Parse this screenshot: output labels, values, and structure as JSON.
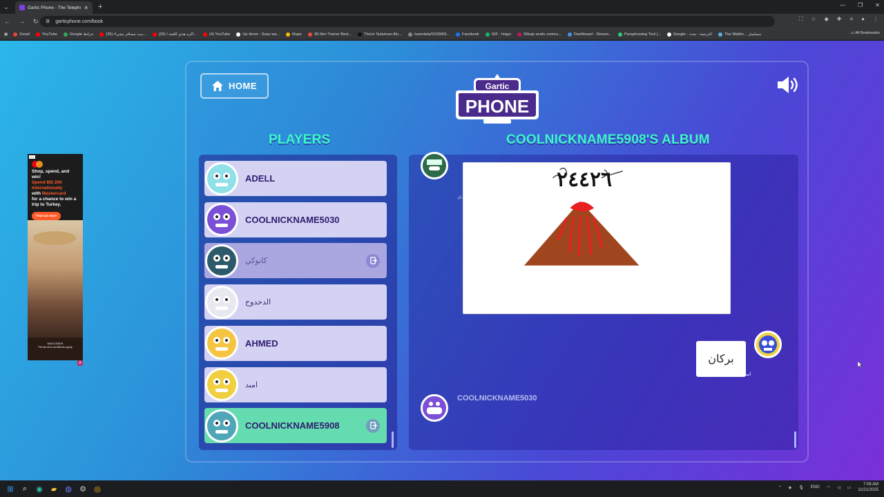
{
  "browser": {
    "tab_title": "Gartic Phone - The Telephone G",
    "new_tab": "+",
    "url": "garticphone.com/book",
    "bookmarks": [
      {
        "label": "Gmail",
        "color": "#ea4335"
      },
      {
        "label": "YouTube",
        "color": "#ff0000"
      },
      {
        "label": "Google خرائط",
        "color": "#34a853"
      },
      {
        "label": "(26) #بيت مسافر بيجي...",
        "color": "#ff0000"
      },
      {
        "label": "(29) اكره هذي اللعبة ا...",
        "color": "#ff0000"
      },
      {
        "label": "(4) YouTube",
        "color": "#ff0000"
      },
      {
        "label": "Up-4ever - Easy wa...",
        "color": "#ffffff"
      },
      {
        "label": "Maps",
        "color": "#fbbc05"
      },
      {
        "label": "3D Aim Trainer Best...",
        "color": "#e74c3c"
      },
      {
        "label": "Tha'er Sulaiman Aln...",
        "color": "#111111"
      },
      {
        "label": "/userdata/01/09/69...",
        "color": "#888888"
      },
      {
        "label": "Facebook",
        "color": "#1877f2"
      },
      {
        "label": "GIF - Imgur",
        "color": "#1bb76e"
      },
      {
        "label": "Dibujo snafu comics...",
        "color": "#c2185b"
      },
      {
        "label": "Dashboard - Stream...",
        "color": "#4a90e2"
      },
      {
        "label": "Paraphrasing Tool |...",
        "color": "#2ecc71"
      },
      {
        "label": "Google - الترجمة - بحث",
        "color": "#ffffff"
      },
      {
        "label": "The Walkin... مسلسل",
        "color": "#5dade2"
      }
    ],
    "all_bookmarks": "All Bookmarks"
  },
  "ad": {
    "tag": "Ad",
    "line1": "Shop, spend, and win!",
    "highlight1": "Spend BD 200 internationally",
    "line2": "with",
    "highlight2": "Mastercard",
    "line3": "for a chance to win a trip to Turkey.",
    "button": "Find out more",
    "footer1": "MOIC/33876",
    "footer2": "*Terms and conditions apply."
  },
  "game": {
    "home_label": "HOME",
    "logo_line1": "Gartic",
    "logo_line2": "PHONE",
    "players_title": "PLAYERS",
    "album_title": "COOLNICKNAME5908'S ALBUM",
    "players": [
      {
        "name": "ADELL",
        "arabic": false,
        "state": "normal",
        "color": "#8fe0e8",
        "kick": false
      },
      {
        "name": "COOLNICKNAME5030",
        "arabic": false,
        "state": "normal",
        "color": "#7b4fd6",
        "kick": false
      },
      {
        "name": "كابوكي",
        "arabic": true,
        "state": "dim",
        "color": "#2d5a6a",
        "kick": true
      },
      {
        "name": "الدحدوح",
        "arabic": true,
        "state": "normal",
        "color": "#e8e8f0",
        "kick": false
      },
      {
        "name": "AHMED",
        "arabic": false,
        "state": "normal",
        "color": "#f5c542",
        "kick": false
      },
      {
        "name": "امبد",
        "arabic": true,
        "state": "normal",
        "color": "#f0d040",
        "kick": false
      },
      {
        "name": "COOLNICKNAME5908",
        "arabic": false,
        "state": "me",
        "color": "#4fa6b8",
        "kick": true
      }
    ],
    "album": {
      "author1": "ددددي",
      "drawing_text": "٢٤٤٢٦",
      "guess_author": "امبد",
      "guess_text": "بركان",
      "author3": "COOLNICKNAME5030"
    }
  },
  "taskbar": {
    "lang": "ENG",
    "time": "7:08 AM",
    "date": "11/21/2025"
  }
}
